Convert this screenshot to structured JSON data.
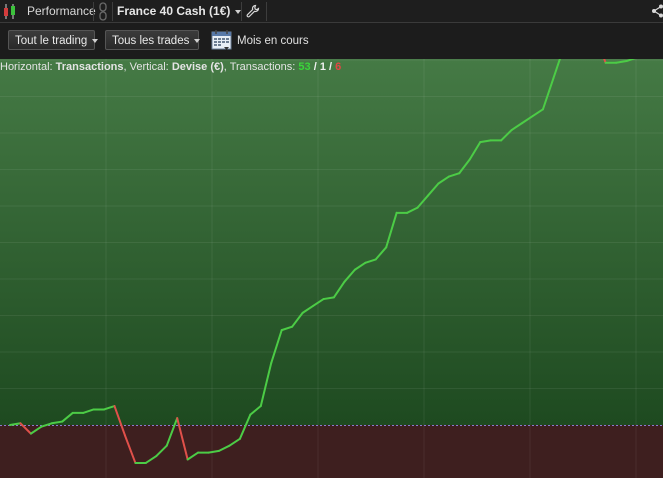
{
  "header": {
    "app_label": "Performance",
    "instrument": "France 40 Cash (1€)"
  },
  "toolbar": {
    "filter_trading": "Tout le trading",
    "filter_trades": "Tous les trades",
    "period": "Mois en cours"
  },
  "info": {
    "horizontal_label": "Horizontal:",
    "horizontal_value": "Transactions",
    "vertical_label": ", Vertical:",
    "vertical_value": "Devise (€)",
    "transactions_label": ", Transactions:",
    "winning": "53",
    "slash1": " / ",
    "neutral": "1",
    "slash2": " / ",
    "losing": "6"
  },
  "colors": {
    "gain_line": "#4ccc46",
    "loss_line": "#e0504a",
    "positive_zone_top": "#457a45",
    "positive_zone_bottom": "#1e4a20",
    "negative_zone": "#3e1f1f",
    "zero_line": "#8a7ad0"
  },
  "chart_data": {
    "type": "line",
    "x": [
      0,
      1,
      2,
      3,
      4,
      5,
      6,
      7,
      8,
      9,
      10,
      11,
      12,
      13,
      14,
      15,
      16,
      17,
      18,
      19,
      20,
      21,
      22,
      23,
      24,
      25,
      26,
      27,
      28,
      29,
      30,
      31,
      32,
      33,
      34,
      35,
      36,
      37,
      38,
      39,
      40,
      41,
      42,
      43,
      44,
      45,
      46,
      47,
      48,
      49,
      50,
      51,
      52,
      53,
      54,
      55,
      56,
      57,
      58,
      59,
      60
    ],
    "y": [
      0,
      0.5,
      -2.5,
      -0.5,
      0.5,
      1,
      3.5,
      3.5,
      4.5,
      4.5,
      5.5,
      -3,
      -11,
      -11,
      -9,
      -6,
      2,
      -10,
      -8,
      -8,
      -7.5,
      -6,
      -4,
      3,
      5.5,
      18,
      27.5,
      28.5,
      32.5,
      34.5,
      36.5,
      37,
      41.5,
      45,
      47,
      48,
      51.5,
      61.5,
      61.5,
      63,
      66.5,
      70,
      72,
      73,
      77,
      82,
      82.5,
      82.5,
      85.5,
      87.5,
      89.5,
      91.5,
      100.5,
      109.5,
      110,
      112,
      113,
      105,
      105,
      105.5,
      106.5
    ],
    "xlabel": "Transactions",
    "ylabel": "Devise (€)"
  }
}
